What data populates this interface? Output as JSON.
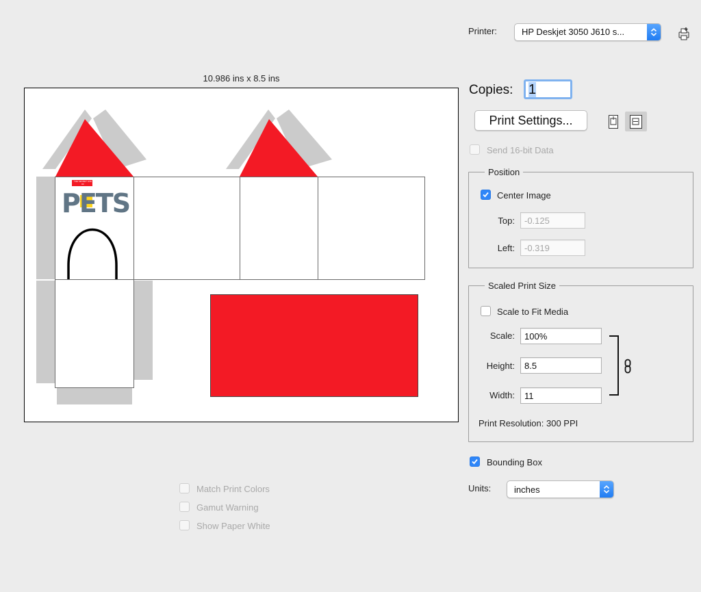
{
  "printer": {
    "label": "Printer:",
    "selected": "HP Deskjet 3050 J610 s..."
  },
  "preview": {
    "dimensions": "10.986 ins x 8.5 ins",
    "logo_text": "PETS",
    "logo_small": "THE SECRET LIFE OF"
  },
  "copies": {
    "label": "Copies:",
    "value": "1"
  },
  "print_settings": {
    "label": "Print Settings..."
  },
  "send_16bit": {
    "label": "Send 16-bit Data",
    "checked": false
  },
  "position": {
    "title": "Position",
    "center_image": {
      "label": "Center Image",
      "checked": true
    },
    "top": {
      "label": "Top:",
      "value": "-0.125"
    },
    "left": {
      "label": "Left:",
      "value": "-0.319"
    }
  },
  "scaled": {
    "title": "Scaled Print Size",
    "scale_to_fit": {
      "label": "Scale to Fit Media",
      "checked": false
    },
    "scale": {
      "label": "Scale:",
      "value": "100%"
    },
    "height": {
      "label": "Height:",
      "value": "8.5"
    },
    "width": {
      "label": "Width:",
      "value": "11"
    },
    "resolution": "Print Resolution: 300 PPI"
  },
  "bounding_box": {
    "label": "Bounding Box",
    "checked": true
  },
  "units": {
    "label": "Units:",
    "selected": "inches"
  },
  "color_options": {
    "match": "Match Print Colors",
    "gamut": "Gamut Warning",
    "paper_white": "Show Paper White"
  },
  "colors": {
    "accent": "#2f86f8",
    "roof_red": "#f31a25",
    "tab_gray": "#cbcbcb",
    "logo_slate": "#607585"
  }
}
